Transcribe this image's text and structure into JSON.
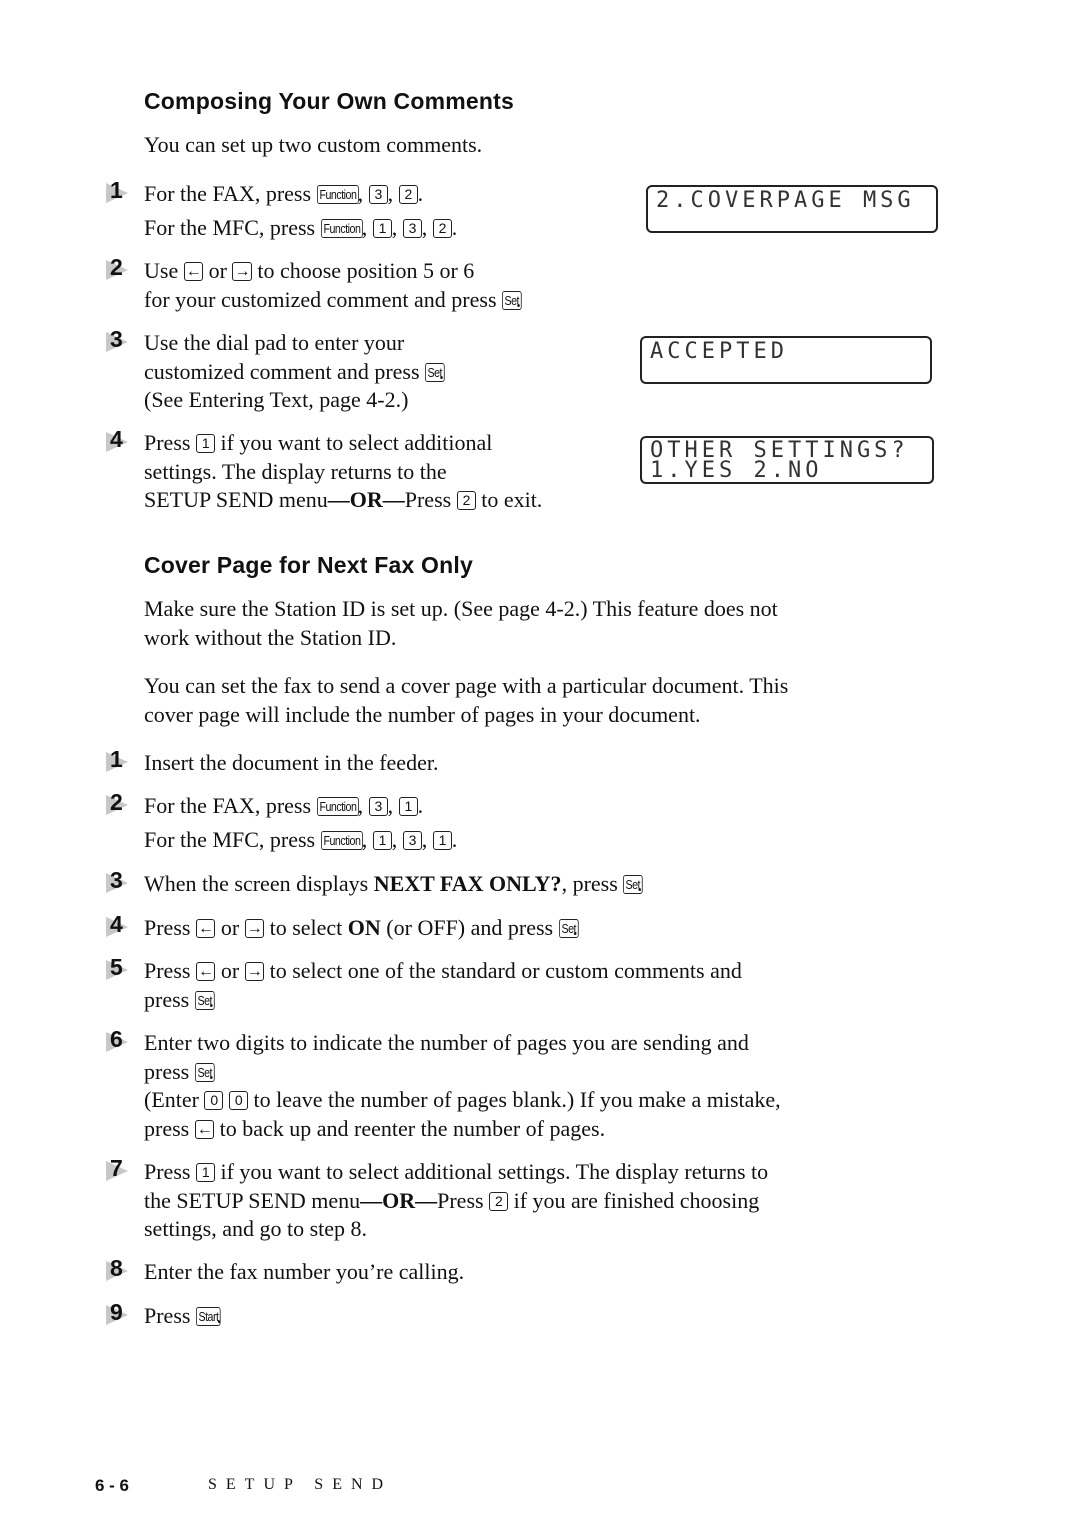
{
  "section1": {
    "heading": "Composing Your Own Comments",
    "intro": "You can set up two custom comments.",
    "steps": [
      {
        "n": "1",
        "lines": [
          {
            "parts": [
              {
                "t": "For the FAX, press "
              },
              {
                "k": "Function"
              },
              {
                "t": ", "
              },
              {
                "k": "3"
              },
              {
                "t": ", "
              },
              {
                "k": "2"
              },
              {
                "t": "."
              }
            ]
          },
          {
            "parts": [
              {
                "t": "For the MFC, press "
              },
              {
                "k": "Function"
              },
              {
                "t": ", "
              },
              {
                "k": "1"
              },
              {
                "t": ", "
              },
              {
                "k": "3"
              },
              {
                "t": ", "
              },
              {
                "k": "2"
              },
              {
                "t": "."
              }
            ]
          }
        ]
      },
      {
        "n": "2",
        "lines": [
          {
            "parts": [
              {
                "t": "Use "
              },
              {
                "k": "←"
              },
              {
                "t": " or "
              },
              {
                "k": "→"
              },
              {
                "t": " to choose position 5 or 6"
              }
            ]
          },
          {
            "parts": [
              {
                "t": "for your customized comment and press "
              },
              {
                "k": "Set"
              },
              {
                "t": "."
              }
            ]
          }
        ]
      },
      {
        "n": "3",
        "lines": [
          {
            "parts": [
              {
                "t": "Use the dial pad to enter your"
              }
            ]
          },
          {
            "parts": [
              {
                "t": "customized comment and press "
              },
              {
                "k": "Set"
              },
              {
                "t": "."
              }
            ]
          },
          {
            "parts": [
              {
                "t": "(See Entering Text, page 4-2.)"
              }
            ]
          }
        ]
      },
      {
        "n": "4",
        "lines": [
          {
            "parts": [
              {
                "t": "Press "
              },
              {
                "k": "1"
              },
              {
                "t": " if you want to select additional"
              }
            ]
          },
          {
            "parts": [
              {
                "t": "settings. The display returns to the"
              }
            ]
          },
          {
            "parts": [
              {
                "t": "SETUP SEND menu"
              },
              {
                "b": "—OR—"
              },
              {
                "t": "Press "
              },
              {
                "k": "2"
              },
              {
                "t": " to exit."
              }
            ]
          }
        ]
      }
    ],
    "lcds": [
      {
        "line1": "2.COVERPAGE MSG",
        "line2": ""
      },
      {
        "line1": "ACCEPTED",
        "line2": ""
      },
      {
        "line1": "OTHER SETTINGS?",
        "line2": "1.YES 2.NO"
      }
    ]
  },
  "section2": {
    "heading": "Cover Page for Next Fax Only",
    "para1": [
      "Make sure the Station ID is set up. (See page 4-2.) This feature does not",
      "work without the Station ID."
    ],
    "para2": [
      "You can set the fax to send a cover page with a particular document. This",
      "cover page will include the number of pages in your document."
    ],
    "steps": [
      {
        "n": "1",
        "lines": [
          {
            "parts": [
              {
                "t": "Insert the document in the feeder."
              }
            ]
          }
        ]
      },
      {
        "n": "2",
        "lines": [
          {
            "parts": [
              {
                "t": "For the FAX, press "
              },
              {
                "k": "Function"
              },
              {
                "t": ", "
              },
              {
                "k": "3"
              },
              {
                "t": ", "
              },
              {
                "k": "1"
              },
              {
                "t": "."
              }
            ]
          },
          {
            "parts": [
              {
                "t": "For the MFC, press "
              },
              {
                "k": "Function"
              },
              {
                "t": ", "
              },
              {
                "k": "1"
              },
              {
                "t": ", "
              },
              {
                "k": "3"
              },
              {
                "t": ", "
              },
              {
                "k": "1"
              },
              {
                "t": "."
              }
            ]
          }
        ]
      },
      {
        "n": "3",
        "lines": [
          {
            "parts": [
              {
                "t": "When the screen displays "
              },
              {
                "b": "NEXT FAX ONLY?"
              },
              {
                "t": ", press "
              },
              {
                "k": "Set"
              },
              {
                "t": "."
              }
            ]
          }
        ]
      },
      {
        "n": "4",
        "lines": [
          {
            "parts": [
              {
                "t": "Press "
              },
              {
                "k": "←"
              },
              {
                "t": " or "
              },
              {
                "k": "→"
              },
              {
                "t": " to select "
              },
              {
                "b": "ON"
              },
              {
                "t": " (or OFF) and press "
              },
              {
                "k": "Set"
              },
              {
                "t": "."
              }
            ]
          }
        ]
      },
      {
        "n": "5",
        "lines": [
          {
            "parts": [
              {
                "t": "Press "
              },
              {
                "k": "←"
              },
              {
                "t": " or "
              },
              {
                "k": "→"
              },
              {
                "t": " to select one of the standard or custom comments and"
              }
            ]
          },
          {
            "parts": [
              {
                "t": "press "
              },
              {
                "k": "Set"
              },
              {
                "t": "."
              }
            ]
          }
        ]
      },
      {
        "n": "6",
        "lines": [
          {
            "parts": [
              {
                "t": "Enter two digits to indicate the number of pages you are sending and"
              }
            ]
          },
          {
            "parts": [
              {
                "t": "press "
              },
              {
                "k": "Set"
              },
              {
                "t": "."
              }
            ]
          },
          {
            "parts": [
              {
                "t": "(Enter "
              },
              {
                "k": "0"
              },
              {
                "t": " "
              },
              {
                "k": "0"
              },
              {
                "t": " to leave the number of pages blank.) If you make a mistake,"
              }
            ]
          },
          {
            "parts": [
              {
                "t": "press "
              },
              {
                "k": "←"
              },
              {
                "t": " to back up and reenter the number of pages."
              }
            ]
          }
        ]
      },
      {
        "n": "7",
        "lines": [
          {
            "parts": [
              {
                "t": "Press "
              },
              {
                "k": "1"
              },
              {
                "t": " if you want to select additional settings. The display returns to"
              }
            ]
          },
          {
            "parts": [
              {
                "t": "the SETUP SEND menu"
              },
              {
                "b": "—OR—"
              },
              {
                "t": "Press "
              },
              {
                "k": "2"
              },
              {
                "t": " if you are finished choosing"
              }
            ]
          },
          {
            "parts": [
              {
                "t": "settings, and go to step 8."
              }
            ]
          }
        ]
      },
      {
        "n": "8",
        "lines": [
          {
            "parts": [
              {
                "t": "Enter the fax number you’re calling."
              }
            ]
          }
        ]
      },
      {
        "n": "9",
        "lines": [
          {
            "parts": [
              {
                "t": "Press "
              },
              {
                "k": "Start"
              },
              {
                "t": "."
              }
            ]
          }
        ]
      }
    ]
  },
  "footer": {
    "page_number": "6 - 6",
    "chapter_title": "SETUP SEND"
  }
}
